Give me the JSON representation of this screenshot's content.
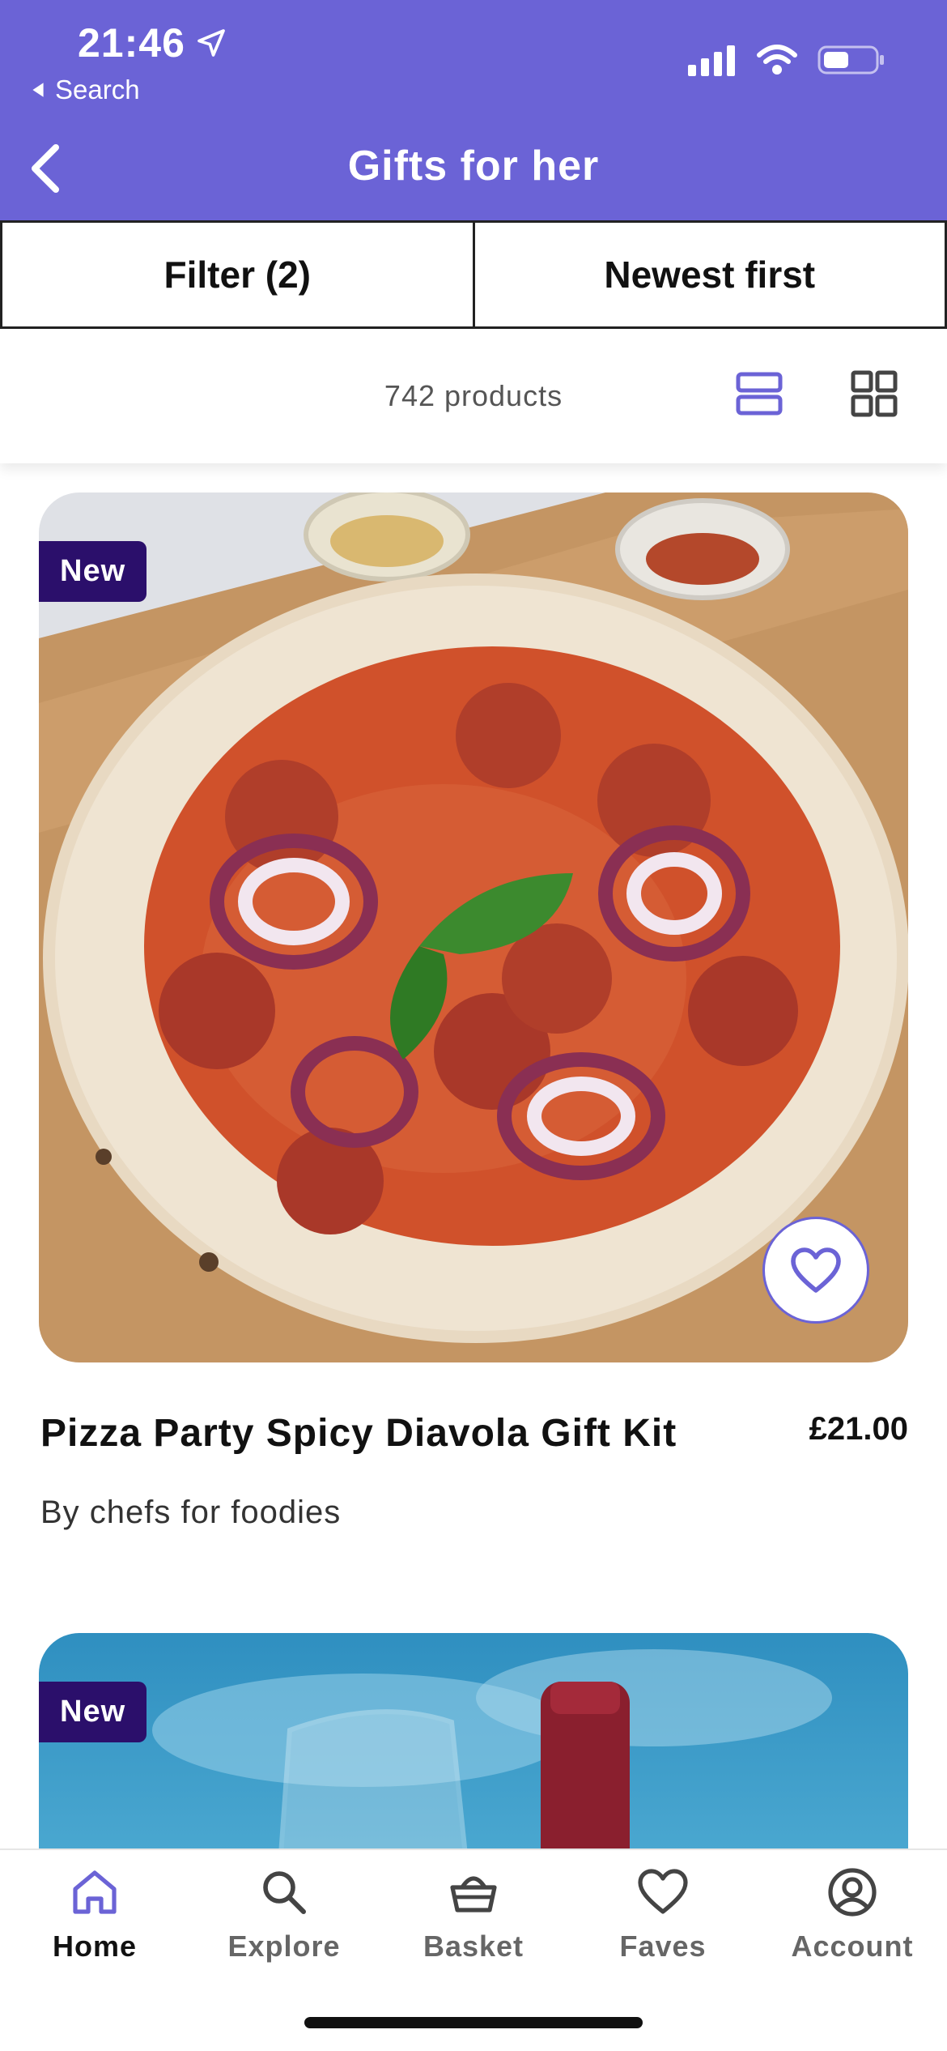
{
  "status_bar": {
    "time": "21:46",
    "back_app": "Search"
  },
  "header": {
    "title": "Gifts for her"
  },
  "toolbar": {
    "filter_label": "Filter (2)",
    "sort_label": "Newest first"
  },
  "results": {
    "count_text": "742 products"
  },
  "products": [
    {
      "badge": "New",
      "title": "Pizza Party Spicy Diavola Gift Kit",
      "price": "£21.00",
      "brand": "By chefs for foodies"
    },
    {
      "badge": "New"
    }
  ],
  "tabs": [
    {
      "label": "Home",
      "icon": "home-icon"
    },
    {
      "label": "Explore",
      "icon": "search-icon"
    },
    {
      "label": "Basket",
      "icon": "basket-icon"
    },
    {
      "label": "Faves",
      "icon": "heart-icon"
    },
    {
      "label": "Account",
      "icon": "account-icon"
    }
  ],
  "colors": {
    "brand": "#6b63d6",
    "badge_bg": "#2b0f6b"
  }
}
